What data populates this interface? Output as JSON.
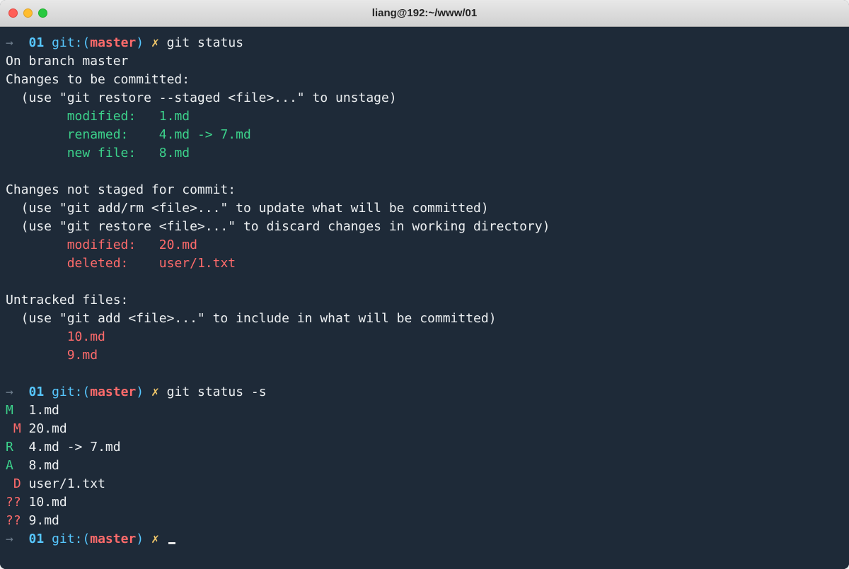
{
  "window": {
    "title": "liang@192:~/www/01"
  },
  "prompt": {
    "arrow": "→",
    "dir": "01",
    "git_label": "git:(",
    "branch": "master",
    "git_close": ")",
    "dirty": "✗"
  },
  "cmd1": "git status",
  "status": {
    "branch_line": "On branch master",
    "staged_header": "Changes to be committed:",
    "staged_hint": "  (use \"git restore --staged <file>...\" to unstage)",
    "staged": [
      {
        "label": "modified:",
        "file": "1.md"
      },
      {
        "label": "renamed:",
        "file": "4.md -> 7.md"
      },
      {
        "label": "new file:",
        "file": "8.md"
      }
    ],
    "unstaged_header": "Changes not staged for commit:",
    "unstaged_hint1": "  (use \"git add/rm <file>...\" to update what will be committed)",
    "unstaged_hint2": "  (use \"git restore <file>...\" to discard changes in working directory)",
    "unstaged": [
      {
        "label": "modified:",
        "file": "20.md"
      },
      {
        "label": "deleted:",
        "file": "user/1.txt"
      }
    ],
    "untracked_header": "Untracked files:",
    "untracked_hint": "  (use \"git add <file>...\" to include in what will be committed)",
    "untracked": [
      "10.md",
      "9.md"
    ]
  },
  "cmd2": "git status -s",
  "short": [
    {
      "x": "M",
      "y": " ",
      "file": "1.md"
    },
    {
      "x": " ",
      "y": "M",
      "file": "20.md"
    },
    {
      "x": "R",
      "y": " ",
      "file": "4.md -> 7.md"
    },
    {
      "x": "A",
      "y": " ",
      "file": "8.md"
    },
    {
      "x": " ",
      "y": "D",
      "file": "user/1.txt"
    },
    {
      "x": "?",
      "y": "?",
      "file": "10.md",
      "untracked": true
    },
    {
      "x": "?",
      "y": "?",
      "file": "9.md",
      "untracked": true
    }
  ]
}
